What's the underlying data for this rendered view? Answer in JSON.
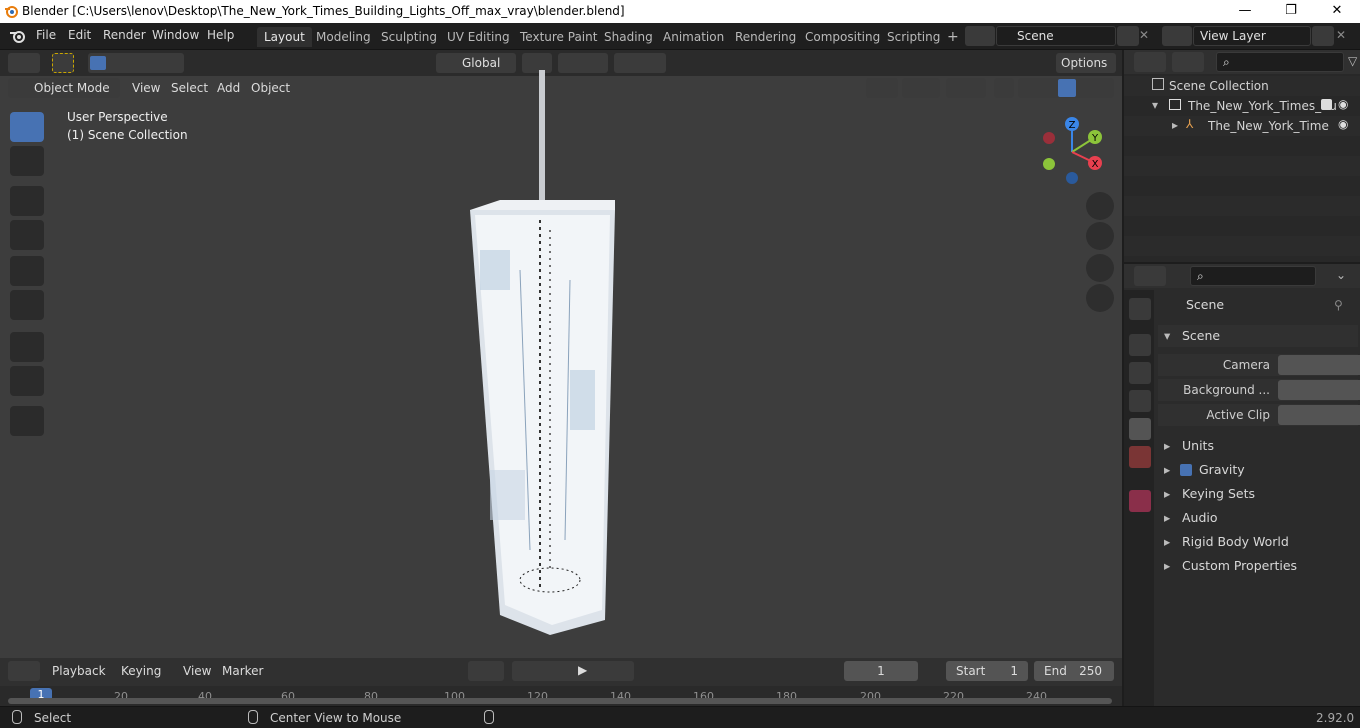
{
  "window": {
    "title": "Blender [C:\\Users\\lenov\\Desktop\\The_New_York_Times_Building_Lights_Off_max_vray\\blender.blend]",
    "minimize": "—",
    "maximize": "❐",
    "close": "✕"
  },
  "menu": [
    "File",
    "Edit",
    "Render",
    "Window",
    "Help"
  ],
  "workspaces": [
    "Layout",
    "Modeling",
    "Sculpting",
    "UV Editing",
    "Texture Paint",
    "Shading",
    "Animation",
    "Rendering",
    "Compositing",
    "Scripting"
  ],
  "active_workspace": "Layout",
  "scene_field": "Scene",
  "view_layer_field": "View Layer",
  "viewport": {
    "transform_orientation": "Global",
    "options_label": "Options",
    "mode": "Object Mode",
    "menus": [
      "View",
      "Select",
      "Add",
      "Object"
    ],
    "overlay_line1": "User Perspective",
    "overlay_line2": "(1) Scene Collection",
    "gizmo_axes": {
      "z": "Z",
      "y": "Y",
      "x": "X"
    }
  },
  "outliner": {
    "root": "Scene Collection",
    "collection": "The_New_York_Times_Bu",
    "object": "The_New_York_Time"
  },
  "properties": {
    "context_title": "Scene",
    "panel_scene": "Scene",
    "camera_label": "Camera",
    "background_label": "Background ...",
    "active_clip_label": "Active Clip",
    "panels": [
      "Units",
      "Gravity",
      "Keying Sets",
      "Audio",
      "Rigid Body World",
      "Custom Properties"
    ],
    "gravity_checked": true
  },
  "timeline": {
    "menus": [
      "Playback",
      "Keying",
      "View",
      "Marker"
    ],
    "current_frame": "1",
    "start_label": "Start",
    "start_value": "1",
    "end_label": "End",
    "end_value": "250",
    "ruler_ticks": [
      "1",
      "20",
      "40",
      "60",
      "80",
      "100",
      "120",
      "140",
      "160",
      "180",
      "200",
      "220",
      "240"
    ]
  },
  "status": {
    "left": "Select",
    "middle": "Center View to Mouse",
    "version": "2.92.0"
  },
  "colors": {
    "accent": "#4772b3",
    "axis_x": "#e8404f",
    "axis_y": "#8cc43a",
    "axis_z": "#3a86e8"
  }
}
